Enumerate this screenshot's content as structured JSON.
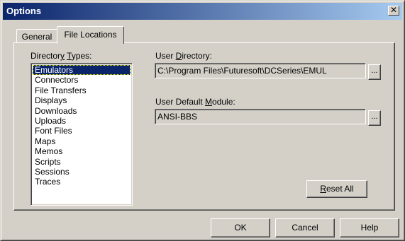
{
  "window": {
    "title": "Options",
    "close_glyph": "✕"
  },
  "tabs": [
    {
      "label": "General",
      "active": false
    },
    {
      "label": "File Locations",
      "active": true
    }
  ],
  "directory_types": {
    "label_pre": "Director",
    "label_accel": "y",
    "label_mid": " ",
    "label_accel2": "T",
    "label_post": "ypes:",
    "items": [
      "Emulators",
      "Connectors",
      "File Transfers",
      "Displays",
      "Downloads",
      "Uploads",
      "Font Files",
      "Maps",
      "Memos",
      "Scripts",
      "Sessions",
      "Traces"
    ],
    "selected_index": 0
  },
  "user_directory": {
    "label_pre": "User ",
    "label_accel": "D",
    "label_post": "irectory:",
    "value": "C:\\Program Files\\Futuresoft\\DCSeries\\EMUL",
    "browse_label": "..."
  },
  "user_default_module": {
    "label_pre": "User Default ",
    "label_accel": "M",
    "label_post": "odule:",
    "value": "ANSI-BBS",
    "browse_label": "..."
  },
  "reset": {
    "accel": "R",
    "rest": "eset All"
  },
  "footer": {
    "ok_label": "OK",
    "cancel_label": "Cancel",
    "help_label": "Help"
  }
}
